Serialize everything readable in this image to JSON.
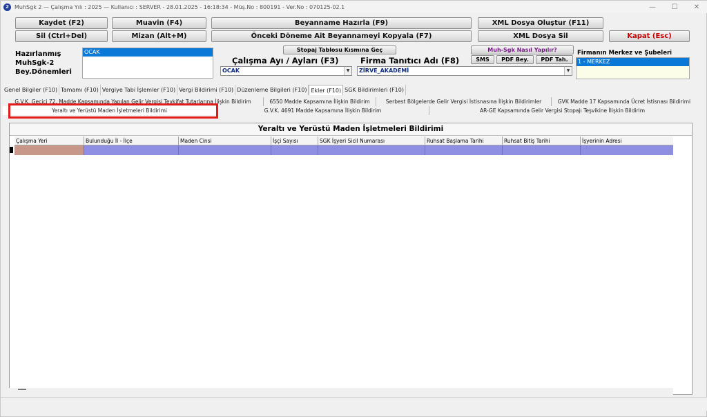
{
  "window": {
    "title": "MuhSgk 2  —  Çalışma Yılı : 2025  —  Kullanıcı : SERVER - 28.01.2025 - 16:18:34 - Müş.No : 800191 - Ver.No : 070125-02.1",
    "controls": [
      "—",
      "☐",
      "✕"
    ]
  },
  "toolbar": {
    "save": "Kaydet (F2)",
    "delete": "Sil (Ctrl+Del)",
    "muavin": "Muavin (F4)",
    "mizan": "Mizan (Alt+M)",
    "prepare": "Beyanname Hazırla (F9)",
    "copy_prev": "Önceki Döneme Ait Beyannameyi Kopyala (F7)",
    "xml_create": "XML Dosya Oluştur (F11)",
    "xml_delete": "XML Dosya Sil",
    "close": "Kapat (Esc)",
    "stopaj_jump": "Stopaj Tablosu Kısmına Geç",
    "how_to": "Muh-Sgk Nasıl Yapılır?",
    "sms": "SMS",
    "pdf_bey": "PDF Bey.",
    "pdf_tah": "PDF Tah."
  },
  "left_panel": {
    "label_line1": "Hazırlanmış",
    "label_line2": "MuhSgk-2",
    "label_line3": "Bey.Dönemleri",
    "list_items": [
      "OCAK"
    ]
  },
  "period": {
    "label": "Çalışma Ayı / Ayları (F3)",
    "value": "OCAK"
  },
  "company": {
    "label": "Firma Tanıtıcı Adı (F8)",
    "value": "ZİRVE_AKADEMİ"
  },
  "branches": {
    "label": "Firmanın Merkez ve Şubeleri",
    "items": [
      "1 - MERKEZ"
    ]
  },
  "tabs": [
    "Genel Bilgiler (F10)",
    "Tamamı (F10)",
    "Vergiye Tabi İşlemler (F10)",
    "Vergi Bildirimi (F10)",
    "Düzenleme Bilgileri (F10)",
    "Ekler (F10)",
    "SGK Bildirimleri (F10)"
  ],
  "subtabs_row1": [
    "G.V.K. Geçici 72. Madde Kapsamında Yapılan Gelir Vergisi Tevkifat Tutarlarına İlişkin Bildirim",
    "6550 Madde Kapsamına İlişkin Bildirim",
    "Serbest Bölgelerde Gelir Vergisi İstisnasına İlişkin Bildirimler",
    "GVK Madde 17 Kapsamında Ücret İstisnası Bildirimi"
  ],
  "subtabs_row2": [
    "Yeraltı ve Yerüstü Maden İşletmeleri Bildirimi",
    "G.V.K. 4691 Madde Kapsamına İlişkin Bildirim",
    "AR-GE Kapsamında Gelir Vergisi Stopajı Teşvikine İlişkin Bildirim"
  ],
  "grid": {
    "title": "Yeraltı ve Yerüstü Maden İşletmeleri Bildirimi",
    "columns": [
      "Çalışma Yeri",
      "Bulunduğu İl - İlçe",
      "Maden Cinsi",
      "İşçi Sayısı",
      "SGK İşyeri Sicil Numarası",
      "Ruhsat Başlama Tarihi",
      "Ruhsat Bitiş Tarihi",
      "İşyerinin Adresi"
    ]
  },
  "colors": {
    "highlight": "#e31b1b",
    "selection": "#0a78d7",
    "row": "#8e8ee2",
    "first_cell": "#c7988a",
    "danger_text": "#c00000"
  }
}
